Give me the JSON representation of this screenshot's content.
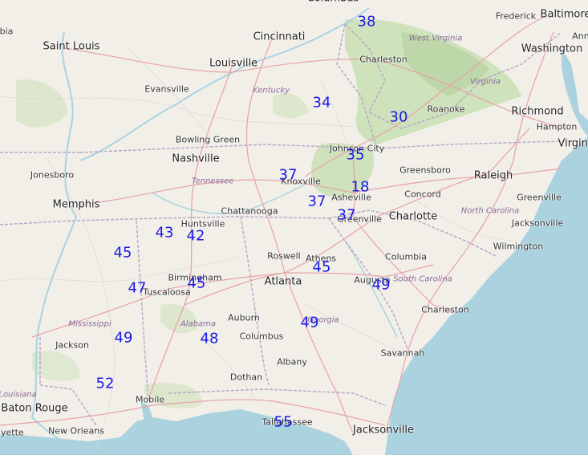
{
  "colors": {
    "land": "#f2efe9",
    "water": "#aad3df",
    "forest": "#c8dfb3",
    "highway": "#e8a0a8",
    "border": "#b9a9c6",
    "value_text": "#1a1ae6"
  },
  "cities": [
    {
      "id": "saint-louis",
      "name": "Saint Louis"
    },
    {
      "id": "cincinnati",
      "name": "Cincinnati"
    },
    {
      "id": "columbus-oh",
      "name": "Columbus"
    },
    {
      "id": "frederick",
      "name": "Frederick"
    },
    {
      "id": "baltimore",
      "name": "Baltimore"
    },
    {
      "id": "washington",
      "name": "Washington"
    },
    {
      "id": "louisville",
      "name": "Louisville"
    },
    {
      "id": "charleston-wv",
      "name": "Charleston"
    },
    {
      "id": "evansville",
      "name": "Evansville"
    },
    {
      "id": "richmond",
      "name": "Richmond"
    },
    {
      "id": "roanoke",
      "name": "Roanoke"
    },
    {
      "id": "hampton",
      "name": "Hampton"
    },
    {
      "id": "bowling-green",
      "name": "Bowling Green"
    },
    {
      "id": "johnson-city",
      "name": "Johnson City"
    },
    {
      "id": "nashville",
      "name": "Nashville"
    },
    {
      "id": "jonesboro",
      "name": "Jonesboro"
    },
    {
      "id": "knoxville",
      "name": "Knoxville"
    },
    {
      "id": "greensboro",
      "name": "Greensboro"
    },
    {
      "id": "raleigh",
      "name": "Raleigh"
    },
    {
      "id": "memphis",
      "name": "Memphis"
    },
    {
      "id": "asheville",
      "name": "Asheville"
    },
    {
      "id": "concord",
      "name": "Concord"
    },
    {
      "id": "greenville-nc",
      "name": "Greenville"
    },
    {
      "id": "chattanooga",
      "name": "Chattanooga"
    },
    {
      "id": "huntsville",
      "name": "Huntsville"
    },
    {
      "id": "greenville-sc",
      "name": "Greenville"
    },
    {
      "id": "charlotte",
      "name": "Charlotte"
    },
    {
      "id": "jacksonville-nc",
      "name": "Jacksonville"
    },
    {
      "id": "wilmington",
      "name": "Wilmington"
    },
    {
      "id": "roswell",
      "name": "Roswell"
    },
    {
      "id": "athens",
      "name": "Athens"
    },
    {
      "id": "columbia",
      "name": "Columbia"
    },
    {
      "id": "birmingham",
      "name": "Birmingham"
    },
    {
      "id": "atlanta",
      "name": "Atlanta"
    },
    {
      "id": "augusta",
      "name": "Augusta"
    },
    {
      "id": "tuscaloosa",
      "name": "Tuscaloosa"
    },
    {
      "id": "charleston-sc",
      "name": "Charleston"
    },
    {
      "id": "auburn",
      "name": "Auburn"
    },
    {
      "id": "columbus-ga",
      "name": "Columbus"
    },
    {
      "id": "jackson",
      "name": "Jackson"
    },
    {
      "id": "savannah",
      "name": "Savannah"
    },
    {
      "id": "albany",
      "name": "Albany"
    },
    {
      "id": "dothan",
      "name": "Dothan"
    },
    {
      "id": "mobile",
      "name": "Mobile"
    },
    {
      "id": "baton-rouge",
      "name": "Baton Rouge"
    },
    {
      "id": "new-orleans",
      "name": "New Orleans"
    },
    {
      "id": "tallahassee",
      "name": "Tallahassee"
    },
    {
      "id": "jacksonville-fl",
      "name": "Jacksonville"
    },
    {
      "id": "lafayette",
      "name": "ayette"
    },
    {
      "id": "columbia-mo",
      "name": "bia"
    },
    {
      "id": "annapolis",
      "name": "Ann"
    },
    {
      "id": "virginia-beach",
      "name": "Virgini"
    }
  ],
  "states": [
    {
      "id": "west-virginia",
      "name": "West Virginia"
    },
    {
      "id": "virginia",
      "name": "Virginia"
    },
    {
      "id": "kentucky",
      "name": "Kentucky"
    },
    {
      "id": "tennessee",
      "name": "Tennessee"
    },
    {
      "id": "north-carolina",
      "name": "North Carolina"
    },
    {
      "id": "south-carolina",
      "name": "South Carolina"
    },
    {
      "id": "georgia",
      "name": "Georgia"
    },
    {
      "id": "alabama",
      "name": "Alabama"
    },
    {
      "id": "mississippi",
      "name": "Mississippi"
    },
    {
      "id": "louisiana",
      "name": "Louisiana"
    }
  ],
  "values": [
    {
      "id": "v1",
      "value": "38"
    },
    {
      "id": "v2",
      "value": "34"
    },
    {
      "id": "v3",
      "value": "30"
    },
    {
      "id": "v4",
      "value": "35"
    },
    {
      "id": "v5",
      "value": "37"
    },
    {
      "id": "v6",
      "value": "18"
    },
    {
      "id": "v7",
      "value": "37"
    },
    {
      "id": "v8",
      "value": "37"
    },
    {
      "id": "v9",
      "value": "43"
    },
    {
      "id": "v10",
      "value": "42"
    },
    {
      "id": "v11",
      "value": "45"
    },
    {
      "id": "v12",
      "value": "47"
    },
    {
      "id": "v13",
      "value": "45"
    },
    {
      "id": "v14",
      "value": "45"
    },
    {
      "id": "v15",
      "value": "49"
    },
    {
      "id": "v16",
      "value": "49"
    },
    {
      "id": "v17",
      "value": "49"
    },
    {
      "id": "v18",
      "value": "48"
    },
    {
      "id": "v19",
      "value": "52"
    },
    {
      "id": "v20",
      "value": "55"
    }
  ]
}
